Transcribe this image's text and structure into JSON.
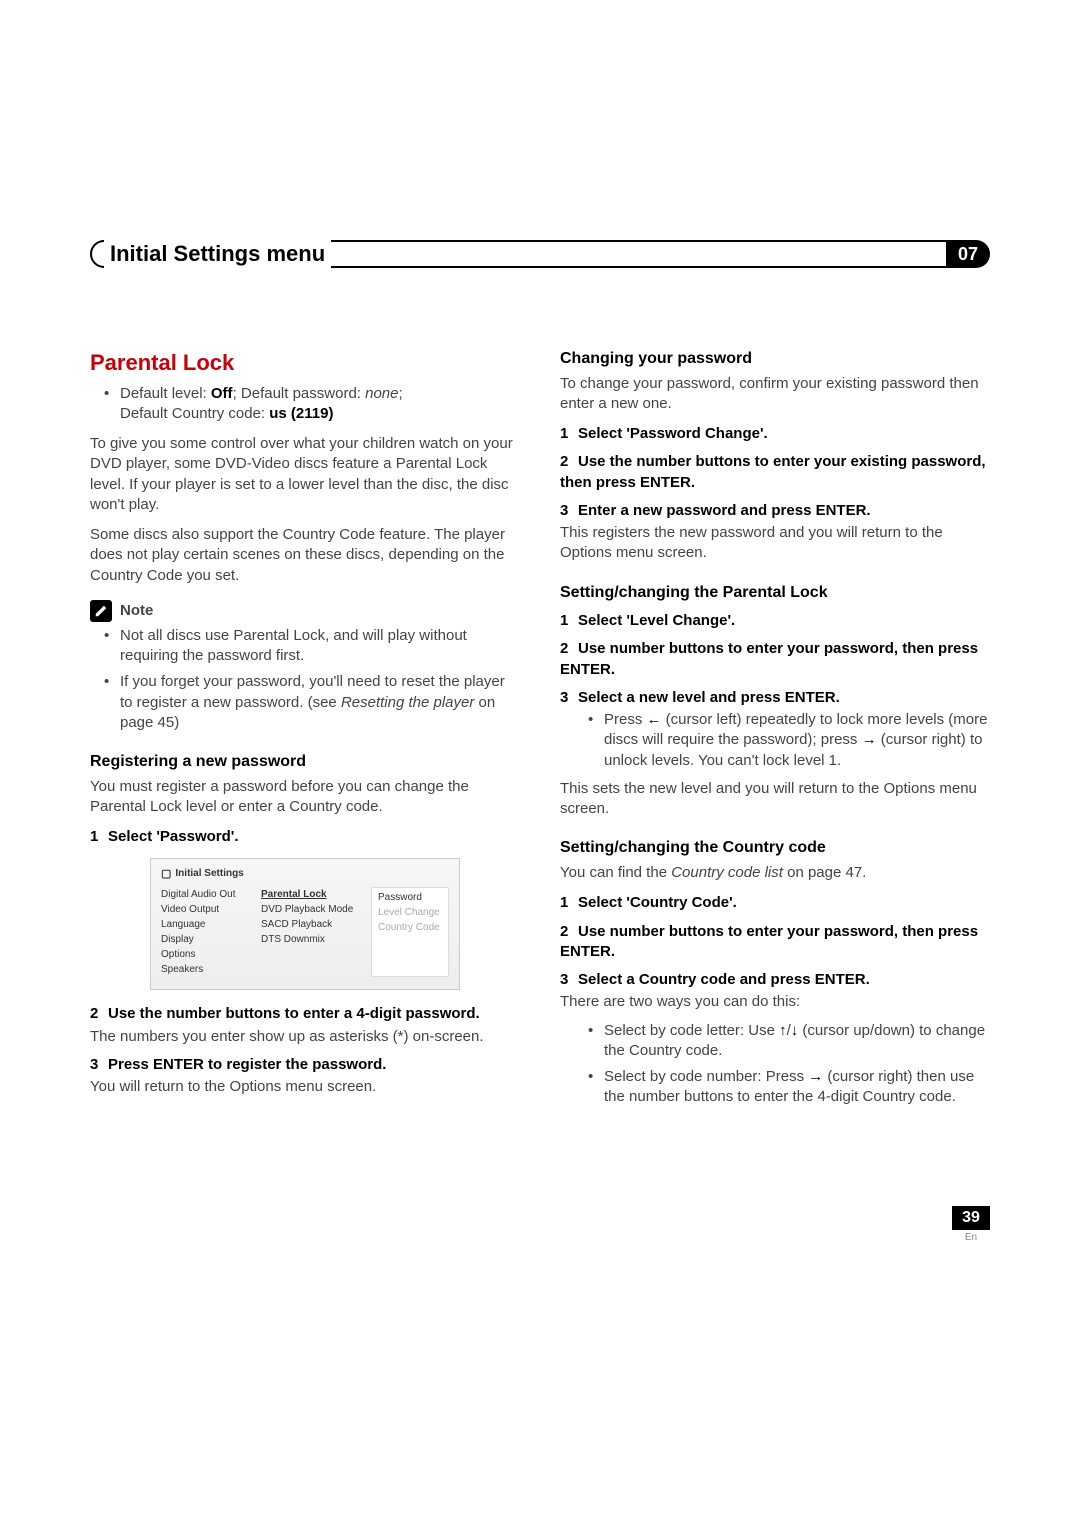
{
  "header": {
    "title": "Initial Settings menu",
    "chapter": "07"
  },
  "left": {
    "h2": "Parental Lock",
    "default_line_pre": "Default level: ",
    "default_level": "Off",
    "default_pw_pre": "; Default password: ",
    "default_pw": "none",
    "default_end": "; ",
    "default_cc_pre": "Default Country code: ",
    "default_cc": "us (2119)",
    "p1": "To give you some control over what your children watch on your DVD player, some DVD-Video discs feature a Parental Lock level. If your player is set to a lower level than the disc, the disc won't play.",
    "p2": "Some discs also support the Country Code feature. The player does not play certain scenes on these discs, depending on the Country Code you set.",
    "note_label": "Note",
    "note_items": [
      "Not all discs use Parental Lock, and will play without requiring the password first.",
      "If you forget your password, you'll need to reset the player to register a new password. (see Resetting the player on page 45)"
    ],
    "reg_h3": "Registering a new password",
    "reg_p": "You must register a password before you can change the Parental Lock level or enter a Country code.",
    "reg_s1": "Select 'Password'.",
    "reg_s2": "Use the number buttons to enter a 4-digit password.",
    "reg_s2_desc": "The numbers you enter show up as asterisks (*) on-screen.",
    "reg_s3": "Press ENTER to register the password.",
    "reg_s3_desc": "You will return to the Options menu screen.",
    "osd": {
      "title": "Initial Settings",
      "col1": [
        "Digital Audio Out",
        "Video Output",
        "Language",
        "Display",
        "Options",
        "Speakers"
      ],
      "col2": [
        "Parental Lock",
        "DVD Playback Mode",
        "SACD Playback",
        "DTS Downmix"
      ],
      "col3": [
        "Password",
        "Level Change",
        "Country Code"
      ]
    }
  },
  "right": {
    "cp_h3": "Changing your password",
    "cp_p": "To change your password, confirm your existing password then enter a new one.",
    "cp_s1": "Select 'Password Change'.",
    "cp_s2": "Use the number buttons to enter your existing password, then press ENTER.",
    "cp_s3": "Enter a new password and press ENTER.",
    "cp_s3_desc": "This registers the new password and you will return to the Options menu screen.",
    "pl_h3": "Setting/changing the Parental Lock",
    "pl_s1": "Select 'Level Change'.",
    "pl_s2": "Use number buttons to enter your password, then press ENTER.",
    "pl_s3": "Select a new level and press ENTER.",
    "pl_s3_b1a": "Press ",
    "pl_s3_b1b": " (cursor left) repeatedly to lock more levels (more discs will require the password); press ",
    "pl_s3_b1c": " (cursor right) to unlock levels. You can't lock level 1.",
    "pl_after": "This sets the new level and you will return to the Options menu screen.",
    "cc_h3": "Setting/changing the Country code",
    "cc_p_a": "You can find the ",
    "cc_p_i": "Country code list",
    "cc_p_b": " on page 47.",
    "cc_s1": "Select 'Country Code'.",
    "cc_s2": "Use number buttons to enter your password, then press ENTER.",
    "cc_s3": "Select a Country code and press ENTER.",
    "cc_s3_desc": "There are two ways you can do this:",
    "cc_b1a": "Select by code letter: Use ",
    "cc_b1b": " (cursor up/down) to change the Country code.",
    "cc_b2a": "Select by code number: Press ",
    "cc_b2b": " (cursor right) then use the number buttons to enter the 4-digit Country code."
  },
  "glyphs": {
    "left": "←",
    "right": "→",
    "up": "↑",
    "updown_sep": "/",
    "down": "↓"
  },
  "footer": {
    "page": "39",
    "lang": "En"
  }
}
